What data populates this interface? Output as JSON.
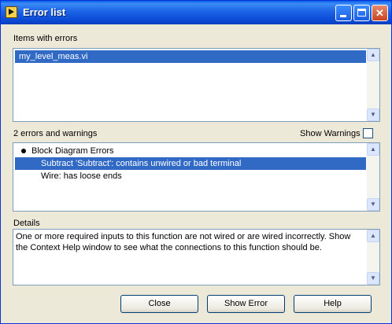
{
  "window": {
    "title": "Error list"
  },
  "items_section": {
    "label": "Items with errors",
    "items": [
      "my_level_meas.vi"
    ]
  },
  "errors_section": {
    "count_label": "2 errors and warnings",
    "show_warnings_label": "Show Warnings",
    "show_warnings_checked": false,
    "group_label": "Block Diagram Errors",
    "entries": [
      "Subtract 'Subtract': contains unwired or bad terminal",
      "Wire: has loose ends"
    ]
  },
  "details_section": {
    "label": "Details",
    "text": "One or more required inputs to this function are not wired or are wired incorrectly. Show the Context Help window to see what the connections to this function should be."
  },
  "buttons": {
    "close": "Close",
    "show_error": "Show Error",
    "help": "Help"
  },
  "colors": {
    "selection": "#316ac5",
    "titlebar": "#0a5ee8",
    "dialog_bg": "#ece9d8"
  }
}
